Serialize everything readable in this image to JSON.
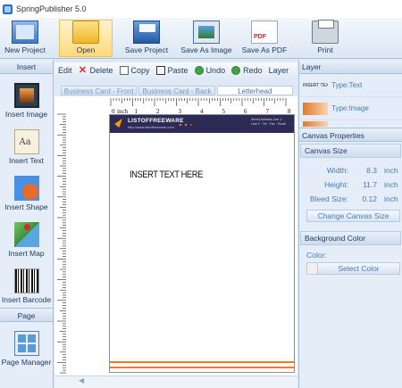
{
  "window": {
    "title": "SpringPublisher 5.0"
  },
  "ribbon": {
    "buttons": [
      {
        "label": "New Project"
      },
      {
        "label": "Open"
      },
      {
        "label": "Save Project"
      },
      {
        "label": "Save As Image"
      },
      {
        "label": "Save As PDF"
      },
      {
        "label": "Print"
      }
    ]
  },
  "insert_panel": {
    "header": "Insert",
    "buttons": [
      {
        "label": "Insert Image"
      },
      {
        "label": "Insert Text"
      },
      {
        "label": "Insert Shape"
      },
      {
        "label": "Insert Map"
      },
      {
        "label": "Insert Barcode"
      }
    ],
    "page_header": "Page",
    "page_button": "Page Manager"
  },
  "editbar": {
    "edit": "Edit",
    "delete": "Delete",
    "copy": "Copy",
    "paste": "Paste",
    "undo": "Undo",
    "redo": "Redo",
    "layer": "Layer"
  },
  "tabs": [
    "Business Card - Front",
    "Business Card - Back",
    "Letterhead"
  ],
  "ruler": {
    "unit": "inch",
    "top_marks": [
      "0",
      "1",
      "2",
      "3",
      "4",
      "5",
      "6",
      "7",
      "8"
    ]
  },
  "document": {
    "brand": "LISTOFFREEWARE",
    "brand_sub": "http://www.listoffreeware.com",
    "contact": "Street Address Line 1 · Line 2 · Tel · Fax · Email",
    "insert_text": "INSERT TEXT HERE"
  },
  "layer_panel": {
    "header": "Layer",
    "items": [
      {
        "thumb": "INSERT TEXT HERE",
        "type": "Type:Text"
      },
      {
        "thumb": "",
        "type": "Type:Image"
      }
    ]
  },
  "canvas_properties": {
    "header": "Canvas Properties",
    "size_section": "Canvas Size",
    "width_label": "Width:",
    "width_value": "8.3",
    "height_label": "Height:",
    "height_value": "11.7",
    "bleed_label": "Bleed Size:",
    "bleed_value": "0.12",
    "unit": "inch",
    "change_button": "Change Canvas Size",
    "bg_section": "Background Color",
    "color_label": "Color:",
    "select_color": "Select Color"
  },
  "colors": {
    "accent_orange": "#f47a20",
    "card_header": "#2b2b55",
    "panel_bg": "#e4edf8"
  }
}
